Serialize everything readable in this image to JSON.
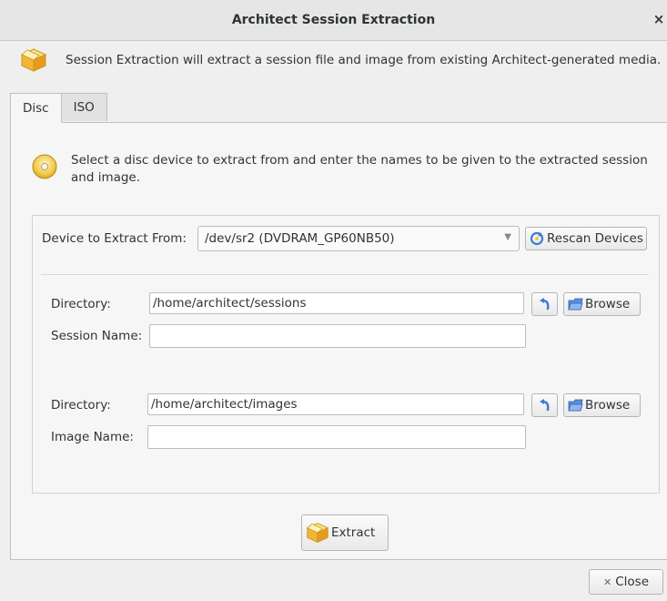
{
  "window": {
    "title": "Architect Session Extraction",
    "close_glyph": "×"
  },
  "header": {
    "message": "Session Extraction will extract a session file and image from existing Architect-generated media.",
    "icon": "box-icon"
  },
  "tabs": [
    {
      "label": "Disc",
      "active": true
    },
    {
      "label": "ISO",
      "active": false
    }
  ],
  "disc": {
    "instructions": "Select a disc device to extract from and enter the names to be given to the extracted session and image.",
    "device_label": "Device to Extract From:",
    "device_value": "/dev/sr2 (DVDRAM_GP60NB50)",
    "rescan_label": "Rescan Devices",
    "session": {
      "directory_label": "Directory:",
      "directory_value": "/home/architect/sessions",
      "name_label": "Session Name:",
      "name_value": "",
      "browse_label": "Browse"
    },
    "image": {
      "directory_label": "Directory:",
      "directory_value": "/home/architect/images",
      "name_label": "Image Name:",
      "name_value": "",
      "browse_label": "Browse"
    },
    "extract_label": "Extract"
  },
  "footer": {
    "close_label": "Close",
    "close_glyph": "✕"
  },
  "colors": {
    "accent_blue": "#3a7bd5",
    "box_yellow": "#f6c342",
    "window_bg": "#efefef"
  }
}
